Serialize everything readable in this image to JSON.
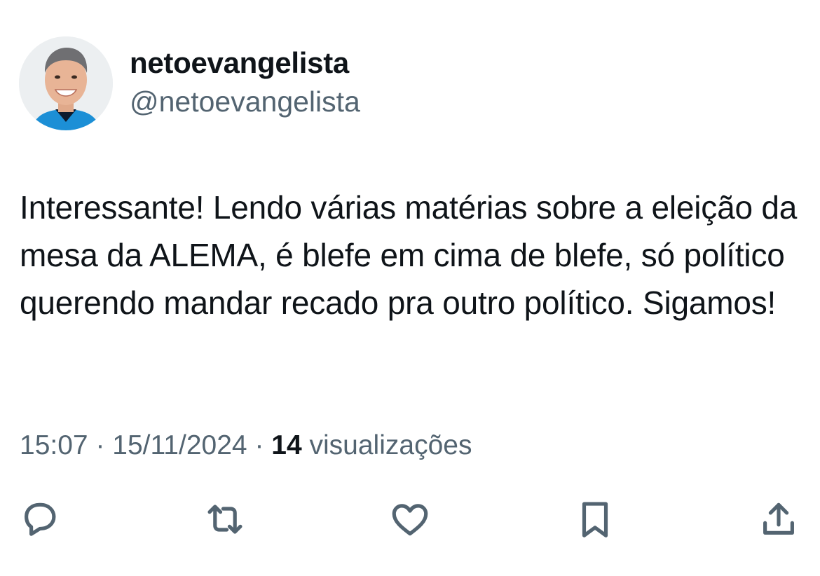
{
  "tweet": {
    "author": {
      "display_name": "netoevangelista",
      "handle": "@netoevangelista",
      "avatar": "profile-photo"
    },
    "text": "Interessante! Lendo várias matérias sobre a eleição da mesa da ALEMA, é blefe em cima de blefe, só político querendo mandar recado pra outro político. Sigamos!",
    "meta": {
      "time": "15:07",
      "separator": "·",
      "date": "15/11/2024",
      "views_count": "14",
      "views_label": "visualizações"
    },
    "actions": [
      {
        "name": "reply",
        "icon": "reply-icon"
      },
      {
        "name": "repost",
        "icon": "repost-icon"
      },
      {
        "name": "like",
        "icon": "heart-icon"
      },
      {
        "name": "bookmark",
        "icon": "bookmark-icon"
      },
      {
        "name": "share",
        "icon": "share-icon"
      }
    ]
  },
  "colors": {
    "primary_text": "#0f1419",
    "secondary_text": "#536471",
    "background": "#ffffff"
  }
}
